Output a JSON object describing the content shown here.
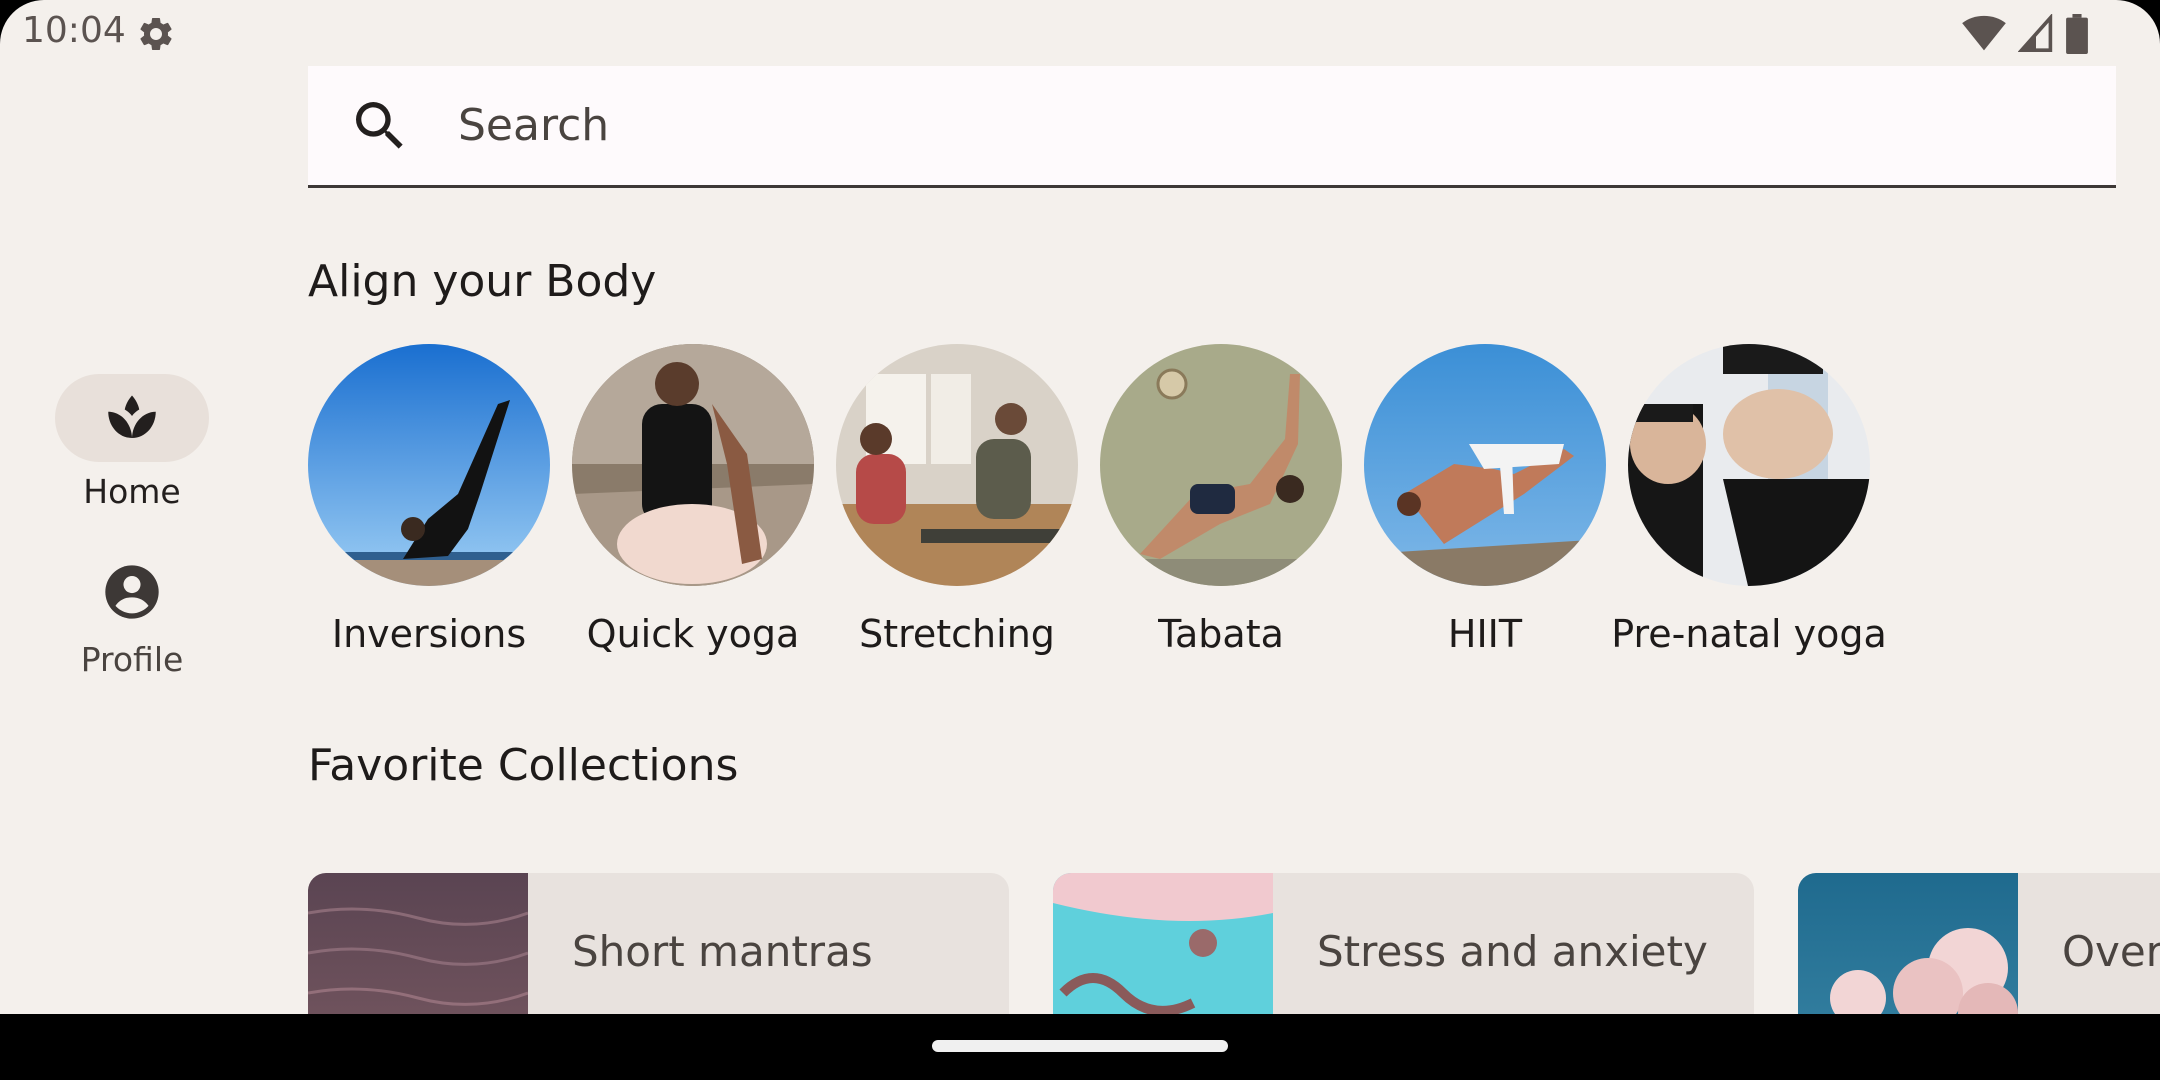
{
  "status_bar": {
    "time": "10:04",
    "icons": [
      "settings-icon",
      "wifi-icon",
      "cell-signal-icon",
      "battery-icon"
    ]
  },
  "nav_rail": {
    "items": [
      {
        "label": "Home",
        "icon": "spa-icon",
        "selected": true
      },
      {
        "label": "Profile",
        "icon": "account-circle-icon",
        "selected": false
      }
    ]
  },
  "search": {
    "placeholder": "Search",
    "icon": "search-icon"
  },
  "align_body": {
    "title": "Align your Body",
    "items": [
      {
        "label": "Inversions"
      },
      {
        "label": "Quick yoga"
      },
      {
        "label": "Stretching"
      },
      {
        "label": "Tabata"
      },
      {
        "label": "HIIT"
      },
      {
        "label": "Pre-natal yoga"
      }
    ]
  },
  "favorite_collections": {
    "title": "Favorite Collections",
    "items": [
      {
        "label": "Short mantras"
      },
      {
        "label": "Stress and anxiety"
      },
      {
        "label": "Overwhelmed"
      }
    ]
  },
  "colors": {
    "background": "#f4f0ec",
    "surface": "#fefafc",
    "card": "#e8e2de",
    "nav_active": "#e8e0da",
    "text": "#1e1b1a"
  }
}
